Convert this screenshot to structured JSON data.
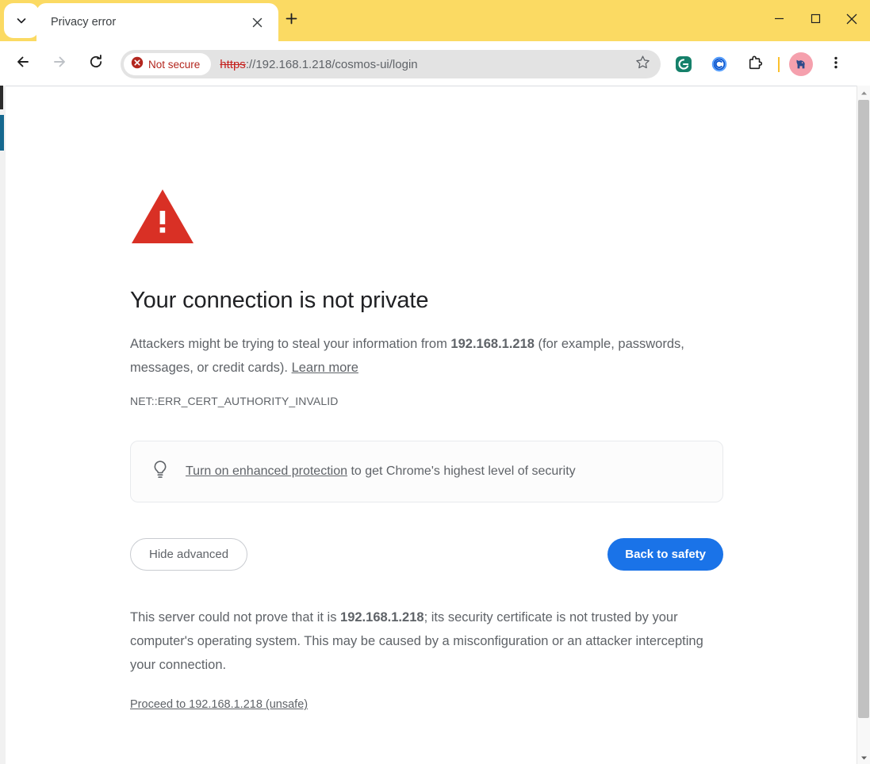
{
  "window": {
    "minimize_label": "Minimize",
    "maximize_label": "Maximize",
    "close_label": "Close",
    "titlebar_color": "#fbda63"
  },
  "tabstrip": {
    "tab_search_label": "Search tabs",
    "new_tab_label": "New tab",
    "tabs": [
      {
        "title": "Privacy error",
        "close_label": "Close tab",
        "active": true
      }
    ]
  },
  "toolbar": {
    "back_label": "Back",
    "forward_label": "Forward",
    "reload_label": "Reload",
    "bookmark_label": "Bookmark this tab",
    "menu_label": "Customize and control Google Chrome",
    "security_chip": "Not secure",
    "security_chip_color": "#b3261e",
    "url_scheme": "https",
    "url_rest": "://192.168.1.218/cosmos-ui/login",
    "url_full": "https://192.168.1.218/cosmos-ui/login",
    "extensions": [
      {
        "name": "grammarly-extension",
        "letter": "G",
        "color": "#15806a"
      },
      {
        "name": "c-extension",
        "letter": "C",
        "color": "#1a73e8"
      },
      {
        "name": "extensions-puzzle",
        "letter": "",
        "color": "#1f1f1f"
      }
    ],
    "divider_color": "#fbc02d",
    "profile_label": "Profile",
    "profile_bg": "#f5a0ad",
    "profile_fg": "#2e4a8a"
  },
  "page": {
    "icon_name": "warning-triangle-icon",
    "icon_color": "#d93025",
    "headline": "Your connection is not private",
    "body_part1": "Attackers might be trying to steal your information from ",
    "body_host": "192.168.1.218",
    "body_part2": " (for example, passwords, messages, or credit cards). ",
    "learn_more": "Learn more",
    "error_code": "NET::ERR_CERT_AUTHORITY_INVALID",
    "enhanced": {
      "icon_name": "lightbulb-icon",
      "link_text": "Turn on enhanced protection",
      "rest_text": " to get Chrome's highest level of security"
    },
    "buttons": {
      "advanced_label": "Hide advanced",
      "safety_label": "Back to safety",
      "safety_color": "#1a73e8"
    },
    "advanced": {
      "part1": "This server could not prove that it is ",
      "host": "192.168.1.218",
      "part2": "; its security certificate is not trusted by your computer's operating system. This may be caused by a misconfiguration or an attacker intercepting your connection.",
      "proceed_link": "Proceed to 192.168.1.218 (unsafe)"
    }
  },
  "scrollbar": {
    "up_label": "Scroll up",
    "down_label": "Scroll down",
    "thumb_label": "Vertical scrollbar thumb"
  }
}
